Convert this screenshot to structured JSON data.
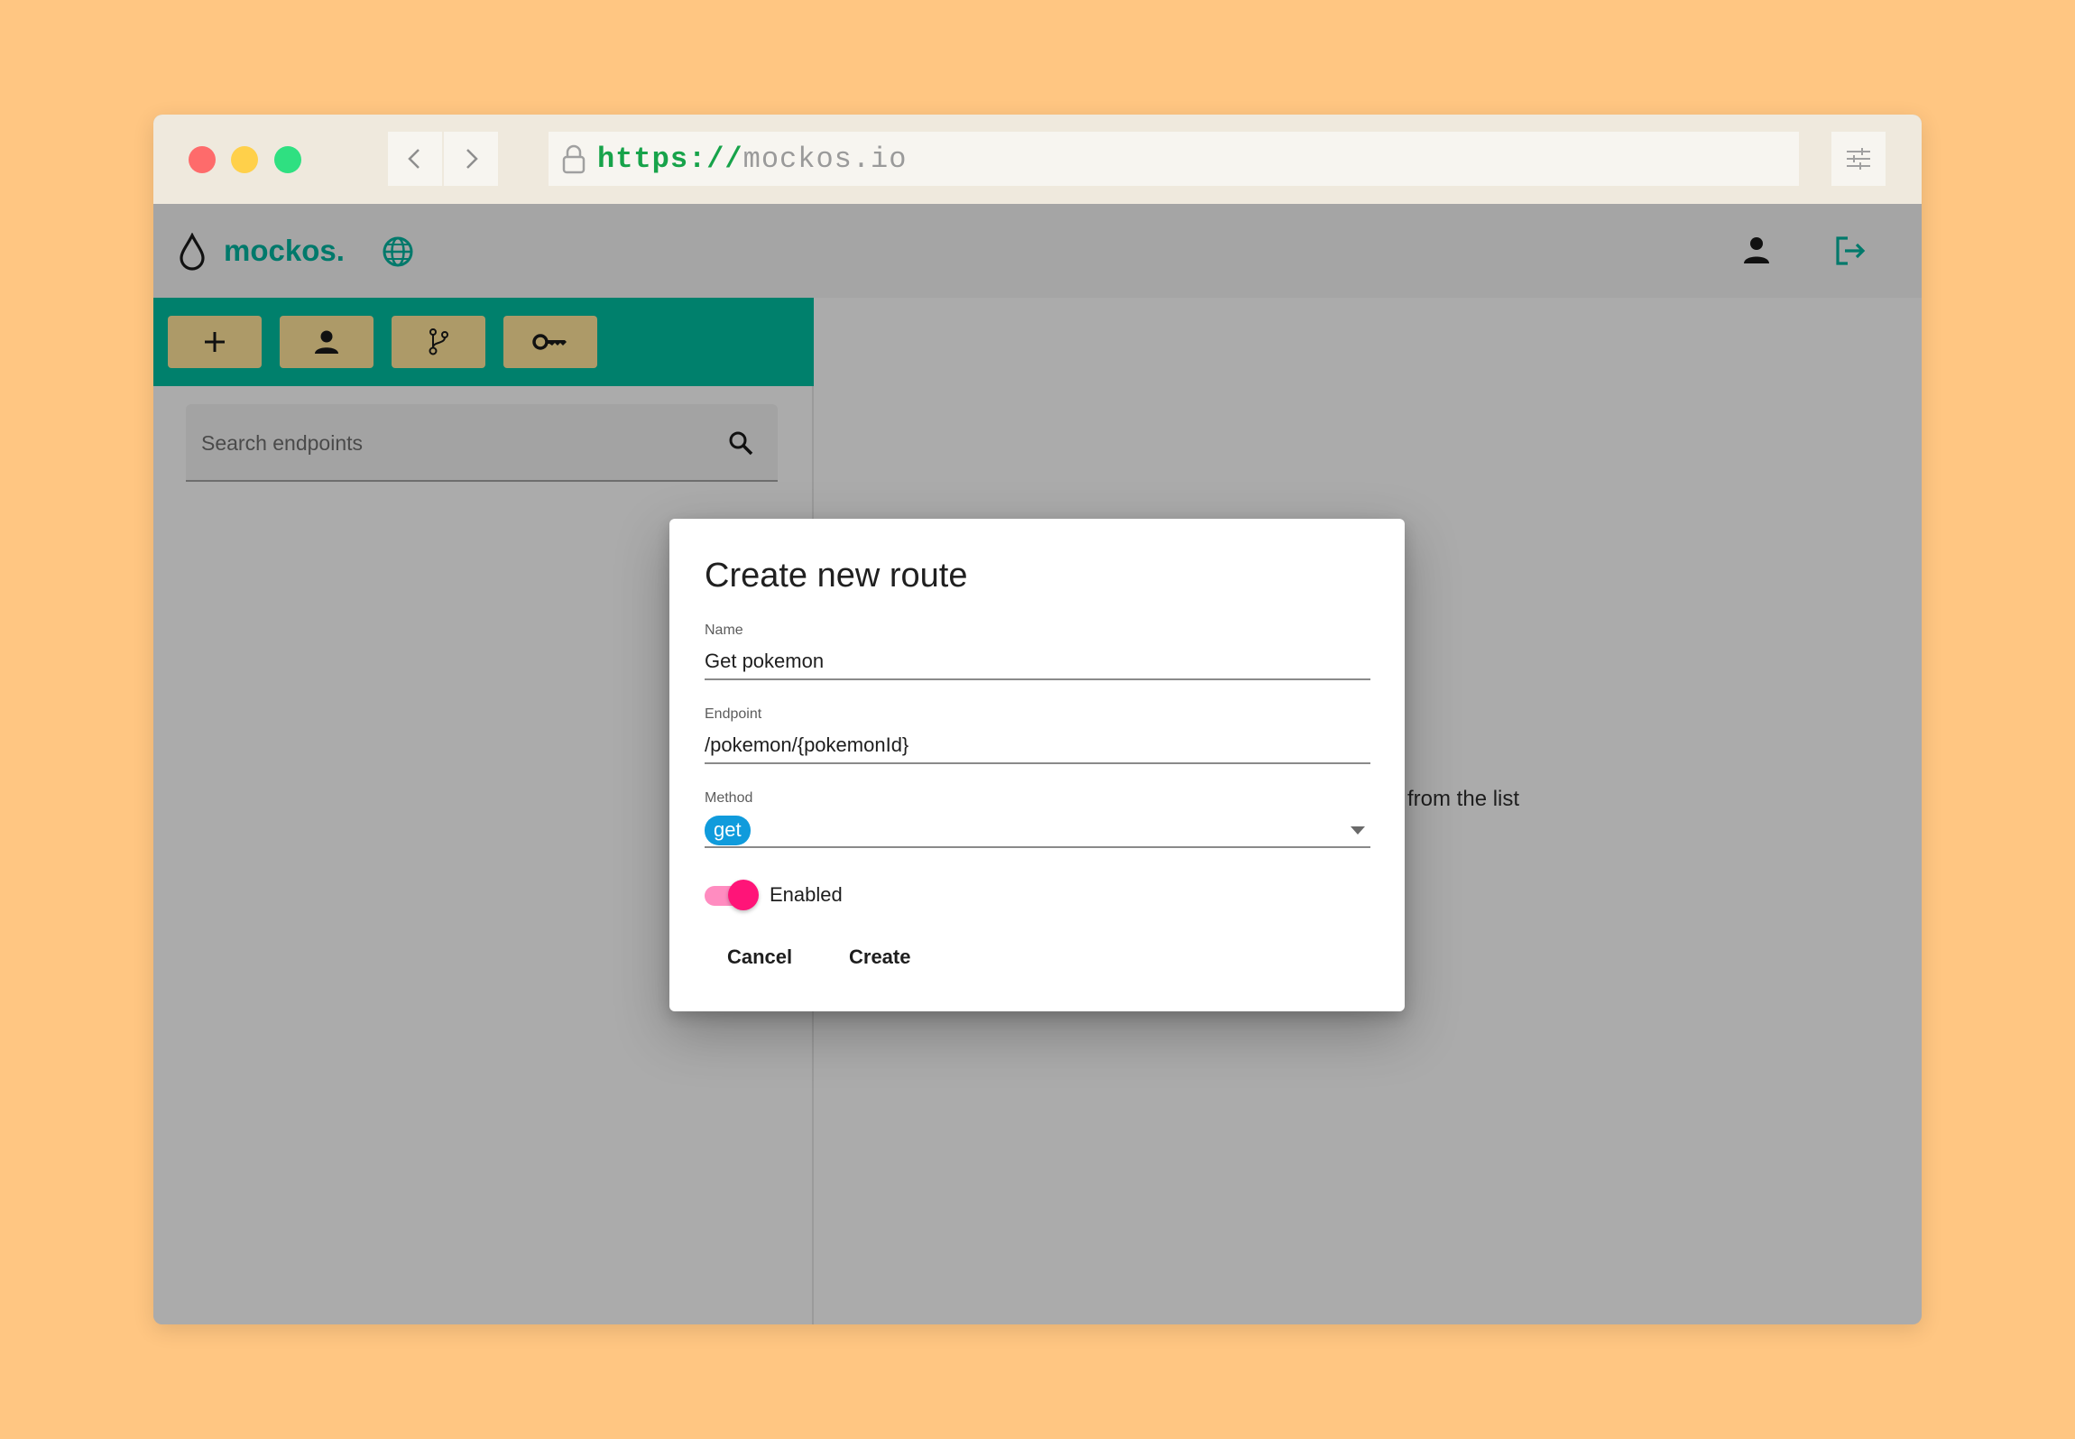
{
  "browser": {
    "url_scheme": "https://",
    "url_host": "mockos.io"
  },
  "app": {
    "brand": "mockos."
  },
  "sidebar": {
    "toolbar": [
      "add-icon",
      "user-icon",
      "git-branch-icon",
      "key-icon"
    ],
    "search_placeholder": "Search endpoints"
  },
  "main": {
    "hint_visible": "e from the list"
  },
  "dialog": {
    "title": "Create new route",
    "name_label": "Name",
    "name_value": "Get pokemon",
    "endpoint_label": "Endpoint",
    "endpoint_value": "/pokemon/{pokemonId}",
    "method_label": "Method",
    "method_value": "get",
    "enabled_label": "Enabled",
    "enabled": true,
    "cancel_label": "Cancel",
    "create_label": "Create"
  },
  "colors": {
    "background": "#ffc682",
    "brand": "#00796b",
    "toolbar": "#00806c",
    "method_chip": "#109bdc",
    "toggle": "#ff1478"
  }
}
